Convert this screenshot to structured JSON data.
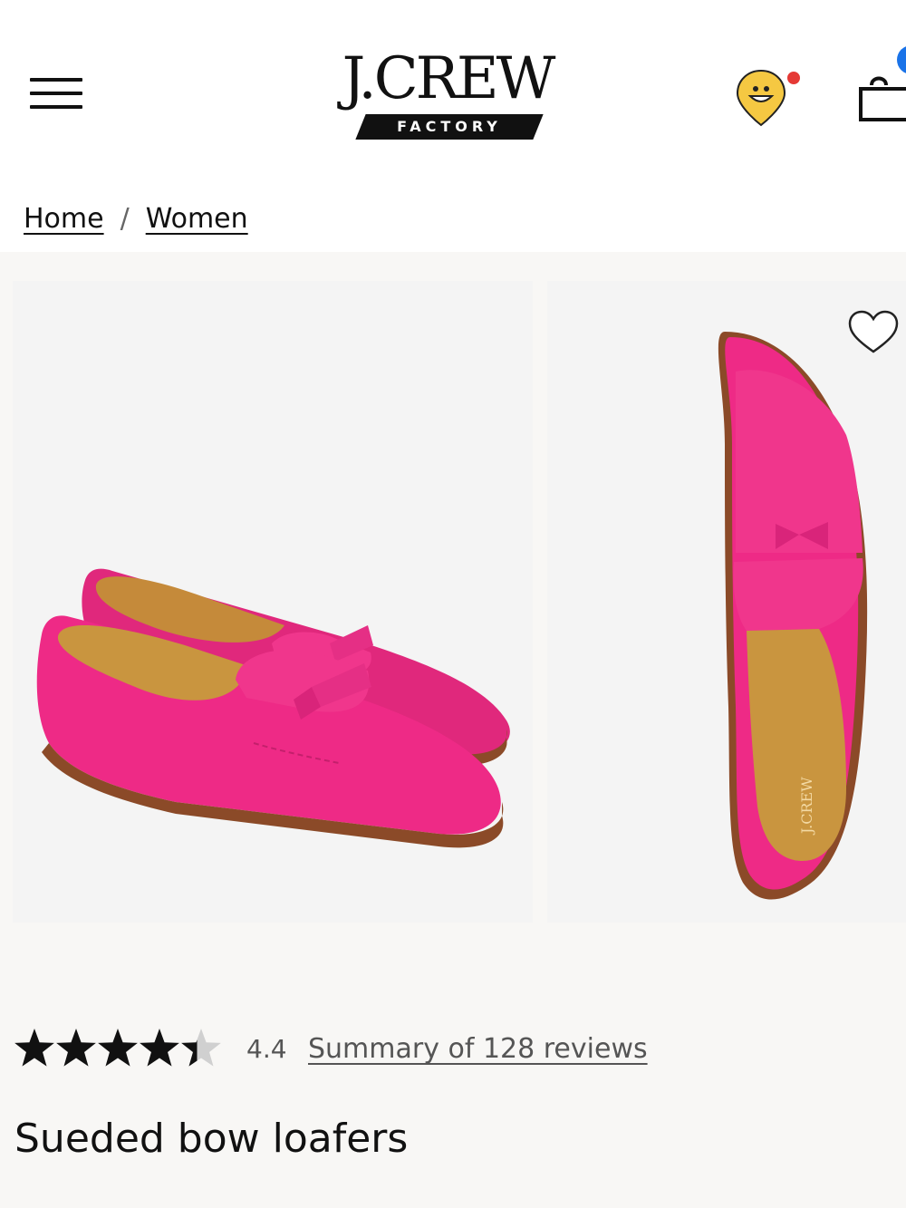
{
  "header": {
    "menu_icon": "hamburger-menu-icon",
    "logo": {
      "name": "J.CREW",
      "sub": "FACTORY"
    },
    "location_icon": "location-pin-smiley-icon",
    "bag_icon": "shopping-bag-icon"
  },
  "breadcrumb": {
    "items": [
      "Home",
      "Women"
    ],
    "separator": "/"
  },
  "gallery": {
    "images": [
      "pink-bow-loafers-pair-side-view",
      "pink-bow-loafer-top-view"
    ],
    "insole_text": "J.CREW",
    "wishlist_icon": "heart-outline-icon"
  },
  "reviews": {
    "rating": "4.4",
    "rating_value": 4.4,
    "max_rating": 5,
    "summary_link": "Summary of 128 reviews"
  },
  "product": {
    "title": "Sueded bow loafers"
  },
  "colors": {
    "shoe_pink": "#ee2a86",
    "insole_tan": "#c9953f",
    "sole_brown": "#8b4a28",
    "notification_red": "#e53935",
    "location_yellow": "#f5c842",
    "badge_blue": "#1a73e8"
  }
}
